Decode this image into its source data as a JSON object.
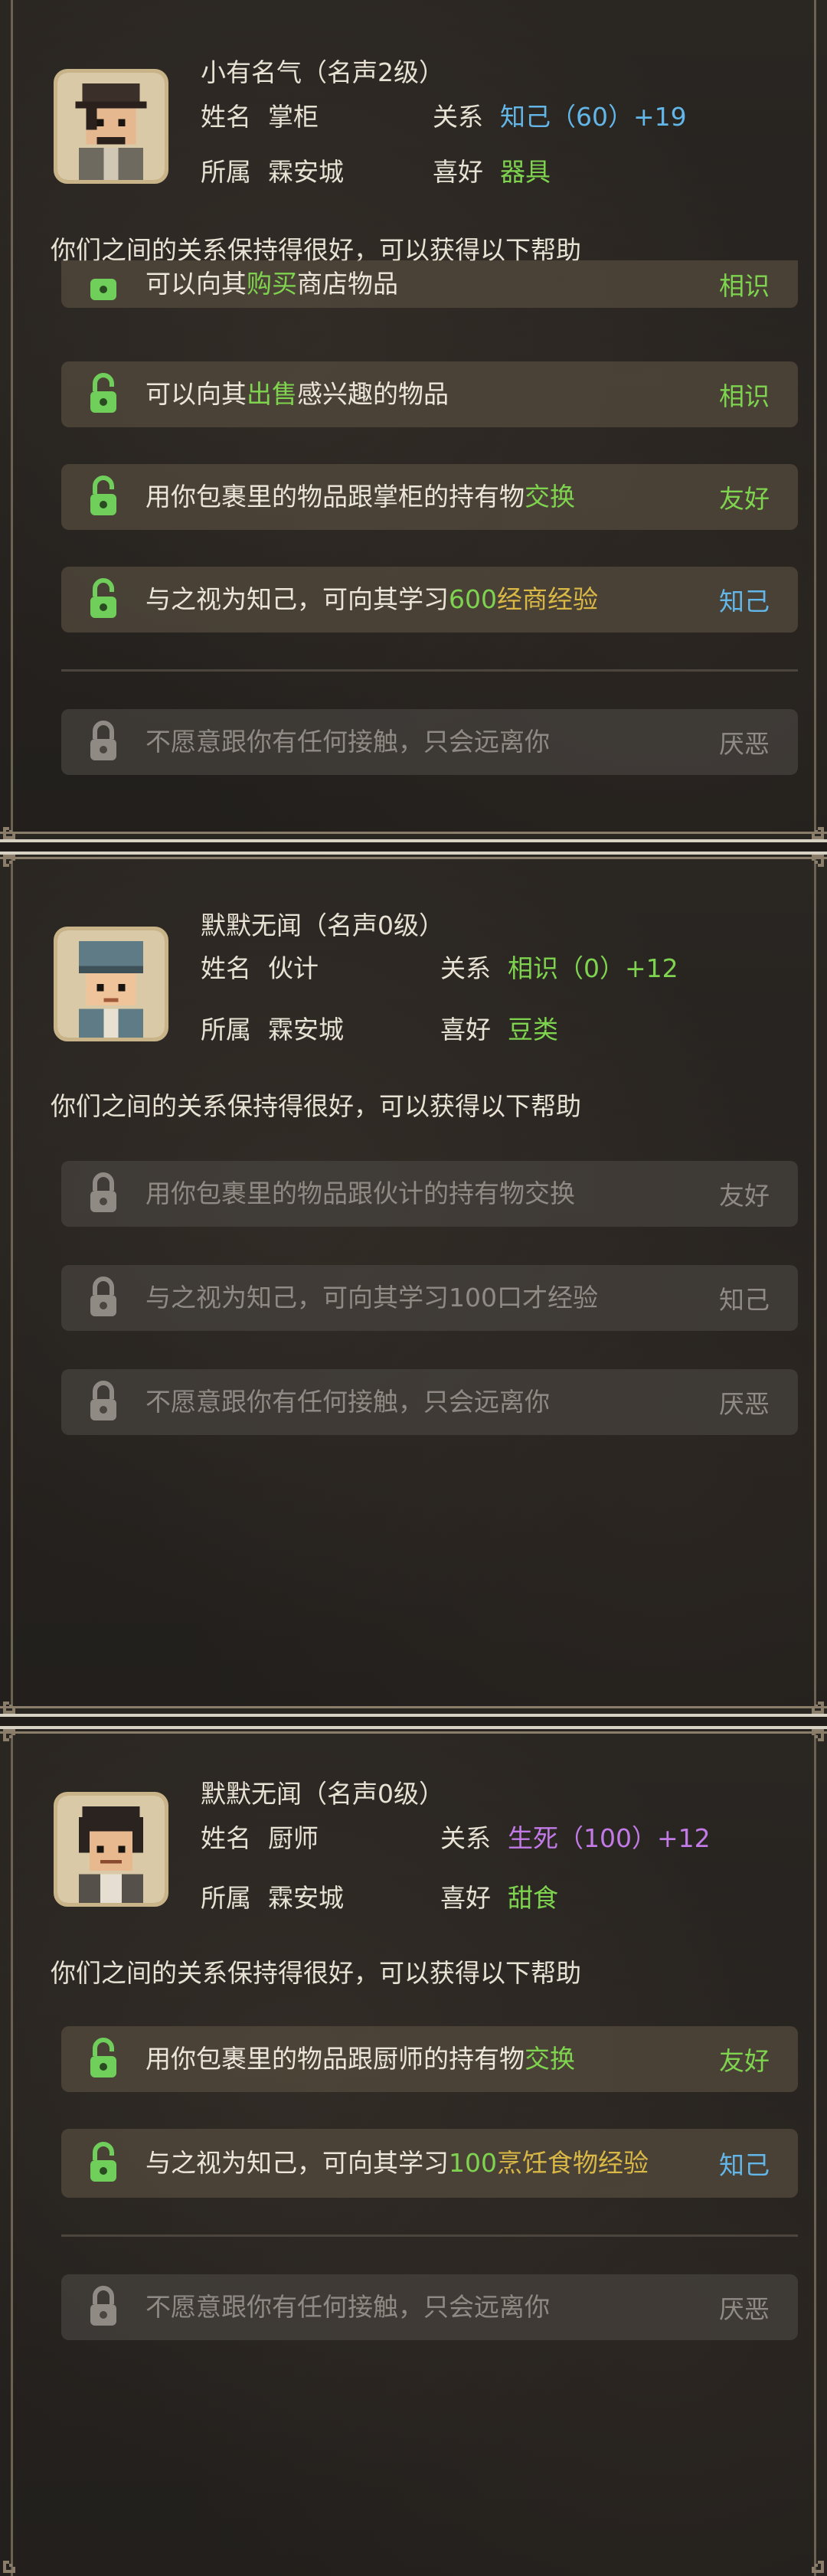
{
  "cards": [
    {
      "title": "小有名气（名声2级）",
      "name_label": "姓名",
      "name": "掌柜",
      "relation_label": "关系",
      "relation_value": "知己（60）+19",
      "affiliation_label": "所属",
      "affiliation": "霖安城",
      "hobby_label": "喜好",
      "hobby": "器具",
      "description": "你们之间的关系保持得很好，可以获得以下帮助",
      "benefits": [
        {
          "pre": "可以向其",
          "hl": "购买",
          "post": "商店物品",
          "tag": "相识"
        },
        {
          "pre": "可以向其",
          "hl": "出售",
          "post": "感兴趣的物品",
          "tag": "相识"
        },
        {
          "pre": "用你包裹里的物品跟掌柜的持有物",
          "hl": "交换",
          "post": "",
          "tag": "友好"
        },
        {
          "pre": "与之视为知己，可向其学习",
          "hl": "600",
          "post": "经商经验",
          "tag": "知己"
        }
      ],
      "locked": [
        {
          "text": "不愿意跟你有任何接触，只会远离你",
          "tag": "厌恶"
        }
      ]
    },
    {
      "title": "默默无闻（名声0级）",
      "name_label": "姓名",
      "name": "伙计",
      "relation_label": "关系",
      "relation_value": "相识（0）+12",
      "affiliation_label": "所属",
      "affiliation": "霖安城",
      "hobby_label": "喜好",
      "hobby": "豆类",
      "description": "你们之间的关系保持得很好，可以获得以下帮助",
      "locked": [
        {
          "text": "用你包裹里的物品跟伙计的持有物交换",
          "tag": "友好"
        },
        {
          "text": "与之视为知己，可向其学习100口才经验",
          "tag": "知己"
        },
        {
          "text": "不愿意跟你有任何接触，只会远离你",
          "tag": "厌恶"
        }
      ]
    },
    {
      "title": "默默无闻（名声0级）",
      "name_label": "姓名",
      "name": "厨师",
      "relation_label": "关系",
      "relation_value": "生死（100）+12",
      "affiliation_label": "所属",
      "affiliation": "霖安城",
      "hobby_label": "喜好",
      "hobby": "甜食",
      "description": "你们之间的关系保持得很好，可以获得以下帮助",
      "benefits": [
        {
          "pre": "用你包裹里的物品跟厨师的持有物",
          "hl": "交换",
          "post": "",
          "tag": "友好"
        },
        {
          "pre": "与之视为知己，可向其学习",
          "hl": "100",
          "post": "烹饪食物经验",
          "tag": "知己"
        }
      ],
      "locked": [
        {
          "text": "不愿意跟你有任何接触，只会远离你",
          "tag": "厌恶"
        }
      ]
    }
  ],
  "colors": {
    "green": "#7fd44f",
    "blue": "#63b6e8",
    "purple": "#c27ae6",
    "yellow": "#d9b846"
  }
}
